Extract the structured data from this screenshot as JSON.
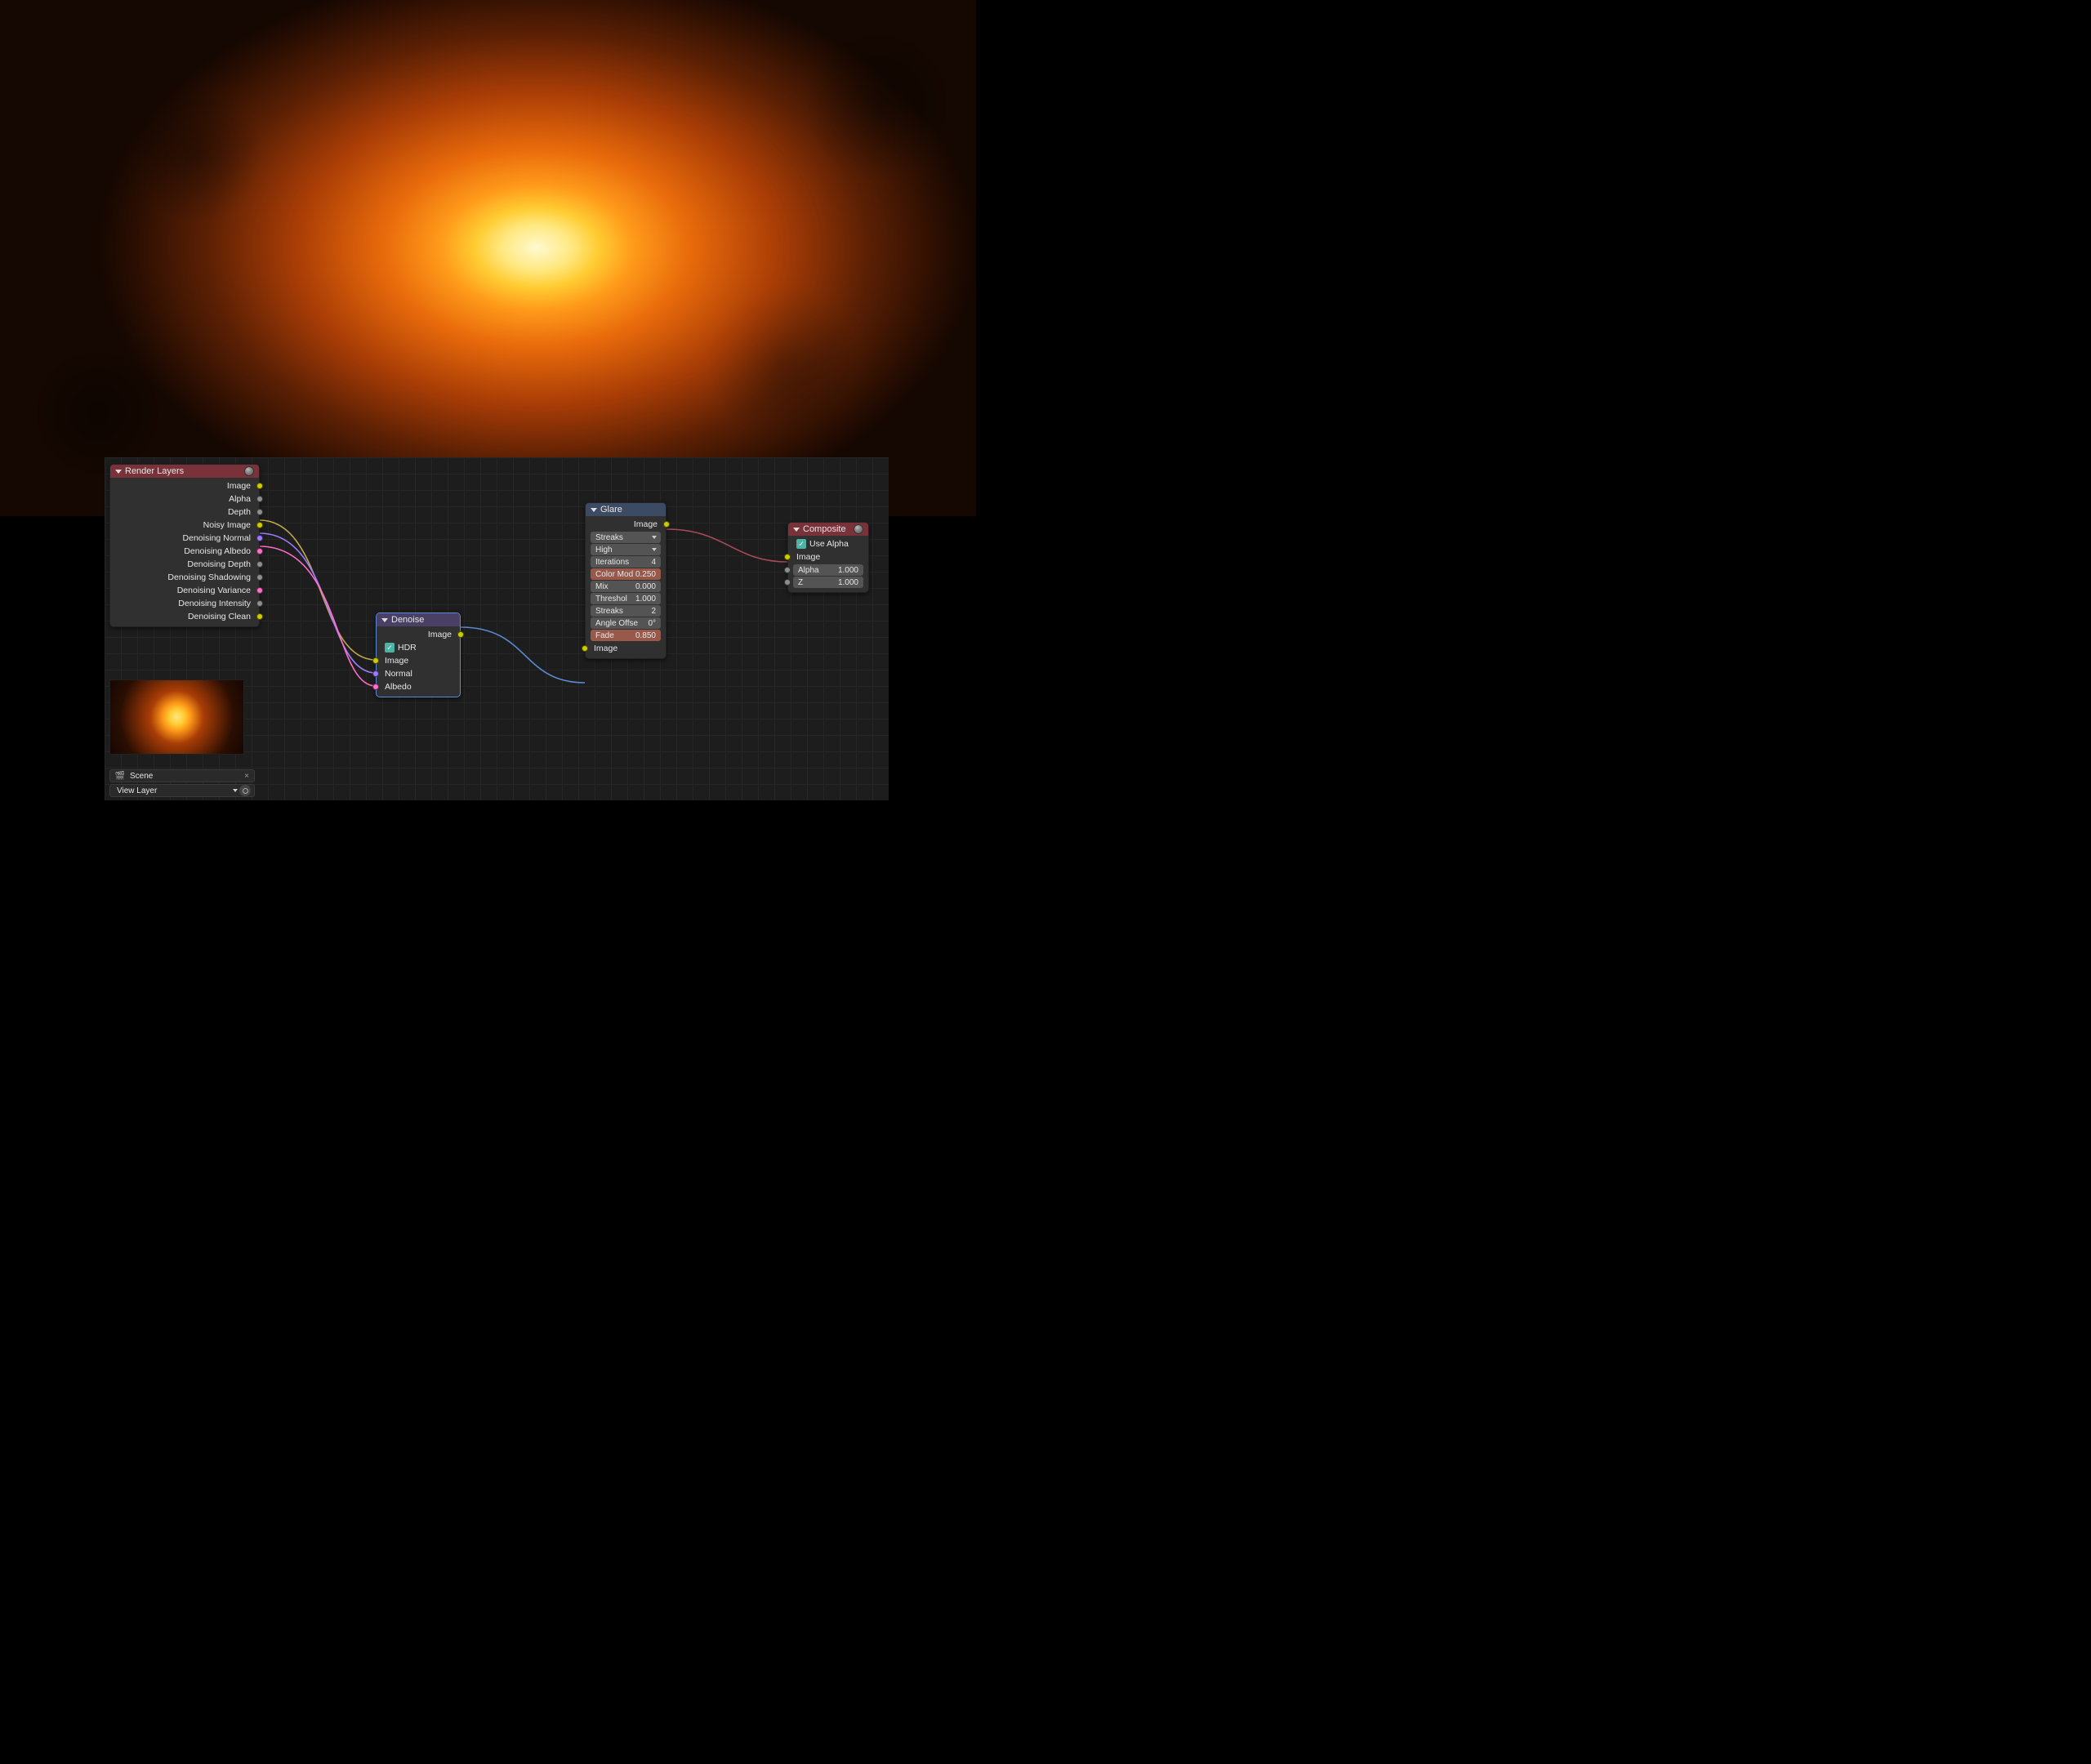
{
  "render_layers": {
    "title": "Render Layers",
    "outputs": [
      {
        "label": "Image",
        "color": "s-yellow"
      },
      {
        "label": "Alpha",
        "color": "s-gray"
      },
      {
        "label": "Depth",
        "color": "s-gray"
      },
      {
        "label": "Noisy Image",
        "color": "s-yellow"
      },
      {
        "label": "Denoising Normal",
        "color": "s-purple"
      },
      {
        "label": "Denoising Albedo",
        "color": "s-pink"
      },
      {
        "label": "Denoising Depth",
        "color": "s-gray"
      },
      {
        "label": "Denoising Shadowing",
        "color": "s-gray"
      },
      {
        "label": "Denoising Variance",
        "color": "s-pink"
      },
      {
        "label": "Denoising Intensity",
        "color": "s-gray"
      },
      {
        "label": "Denoising Clean",
        "color": "s-yellow"
      }
    ]
  },
  "denoise": {
    "title": "Denoise",
    "out_image": "Image",
    "hdr": "HDR",
    "inputs": [
      {
        "label": "Image",
        "color": "s-yellow"
      },
      {
        "label": "Normal",
        "color": "s-purple"
      },
      {
        "label": "Albedo",
        "color": "s-pink"
      }
    ]
  },
  "glare": {
    "title": "Glare",
    "out_image": "Image",
    "type": "Streaks",
    "quality": "High",
    "iterations_k": "Iterations",
    "iterations_v": "4",
    "colormod_k": "Color Mod",
    "colormod_v": "0.250",
    "mix_k": "Mix",
    "mix_v": "0.000",
    "threshold_k": "Threshol",
    "threshold_v": "1.000",
    "streaks_k": "Streaks",
    "streaks_v": "2",
    "angle_k": "Angle Offse",
    "angle_v": "0°",
    "fade_k": "Fade",
    "fade_v": "0.850",
    "in_image": "Image"
  },
  "composite": {
    "title": "Composite",
    "use_alpha": "Use Alpha",
    "in_image": "Image",
    "alpha_k": "Alpha",
    "alpha_v": "1.000",
    "z_k": "Z",
    "z_v": "1.000"
  },
  "footer": {
    "scene": "Scene",
    "view_layer": "View Layer"
  }
}
